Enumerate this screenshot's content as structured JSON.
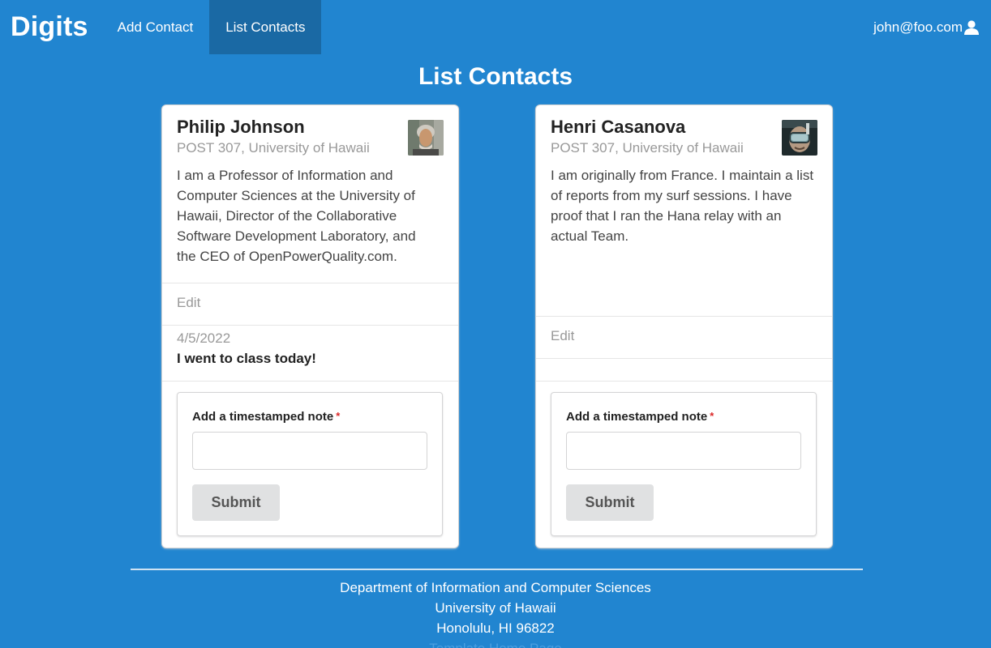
{
  "navbar": {
    "brand": "Digits",
    "items": [
      {
        "label": "Add Contact",
        "active": false
      },
      {
        "label": "List Contacts",
        "active": true
      }
    ],
    "user": {
      "email": "john@foo.com",
      "icon": "user-icon"
    }
  },
  "page": {
    "title": "List Contacts"
  },
  "contacts": [
    {
      "name": "Philip Johnson",
      "address": "POST 307, University of Hawaii",
      "description": "I am a Professor of Information and Computer Sciences at the University of Hawaii, Director of the Collaborative Software Development Laboratory, and the CEO of OpenPowerQuality.com.",
      "edit_label": "Edit",
      "notes": [
        {
          "date": "4/5/2022",
          "text": "I went to class today!"
        }
      ],
      "form": {
        "label": "Add a timestamped note",
        "required_mark": "*",
        "input_value": "",
        "submit_label": "Submit"
      }
    },
    {
      "name": "Henri Casanova",
      "address": "POST 307, University of Hawaii",
      "description": "I am originally from France. I maintain a list of reports from my surf sessions. I have proof that I ran the Hana relay with an actual Team.",
      "edit_label": "Edit",
      "notes": [],
      "form": {
        "label": "Add a timestamped note",
        "required_mark": "*",
        "input_value": "",
        "submit_label": "Submit"
      }
    }
  ],
  "footer": {
    "line1": "Department of Information and Computer Sciences",
    "line2": "University of Hawaii",
    "line3": "Honolulu, HI 96822",
    "line4": "Template Home Page"
  },
  "colors": {
    "background": "#2185d0",
    "nav_active": "#1a69a4",
    "required": "#db2828"
  }
}
